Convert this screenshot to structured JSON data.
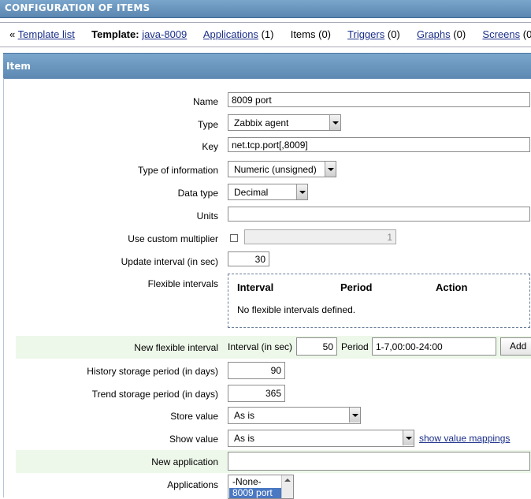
{
  "header": {
    "title": "CONFIGURATION OF ITEMS"
  },
  "nav": {
    "prefix": "«",
    "template_list": "Template list",
    "template_label": "Template:",
    "template_name": "java-8009",
    "applications_label": "Applications",
    "applications_count": "(1)",
    "items_label": "Items",
    "items_count": "(0)",
    "triggers_label": "Triggers",
    "triggers_count": "(0)",
    "graphs_label": "Graphs",
    "graphs_count": "(0)",
    "screens_label": "Screens",
    "screens_count": "(0)"
  },
  "section": {
    "title": "Item"
  },
  "form": {
    "name": {
      "label": "Name",
      "value": "8009 port"
    },
    "type": {
      "label": "Type",
      "value": "Zabbix agent"
    },
    "key": {
      "label": "Key",
      "value": "net.tcp.port[,8009]"
    },
    "type_of_information": {
      "label": "Type of information",
      "value": "Numeric (unsigned)"
    },
    "data_type": {
      "label": "Data type",
      "value": "Decimal"
    },
    "units": {
      "label": "Units",
      "value": ""
    },
    "custom_multiplier": {
      "label": "Use custom multiplier",
      "value": "1",
      "checked": false
    },
    "update_interval": {
      "label": "Update interval (in sec)",
      "value": "30"
    },
    "flexible_intervals": {
      "label": "Flexible intervals",
      "col_interval": "Interval",
      "col_period": "Period",
      "col_action": "Action",
      "empty": "No flexible intervals defined."
    },
    "new_flexible_interval": {
      "label": "New flexible interval",
      "interval_label": "Interval (in sec)",
      "interval_value": "50",
      "period_label": "Period",
      "period_value": "1-7,00:00-24:00",
      "add_button": "Add"
    },
    "history": {
      "label": "History storage period (in days)",
      "value": "90"
    },
    "trend": {
      "label": "Trend storage period (in days)",
      "value": "365"
    },
    "store_value": {
      "label": "Store value",
      "value": "As is"
    },
    "show_value": {
      "label": "Show value",
      "value": "As is",
      "link": "show value mappings"
    },
    "new_application": {
      "label": "New application",
      "value": ""
    },
    "applications": {
      "label": "Applications",
      "options": [
        "-None-",
        "8009 port"
      ],
      "selected": "8009 port"
    }
  },
  "colors": {
    "header_blue": "#5a86b0",
    "link": "#1b2f8a",
    "row_highlight": "#eef8ea"
  }
}
